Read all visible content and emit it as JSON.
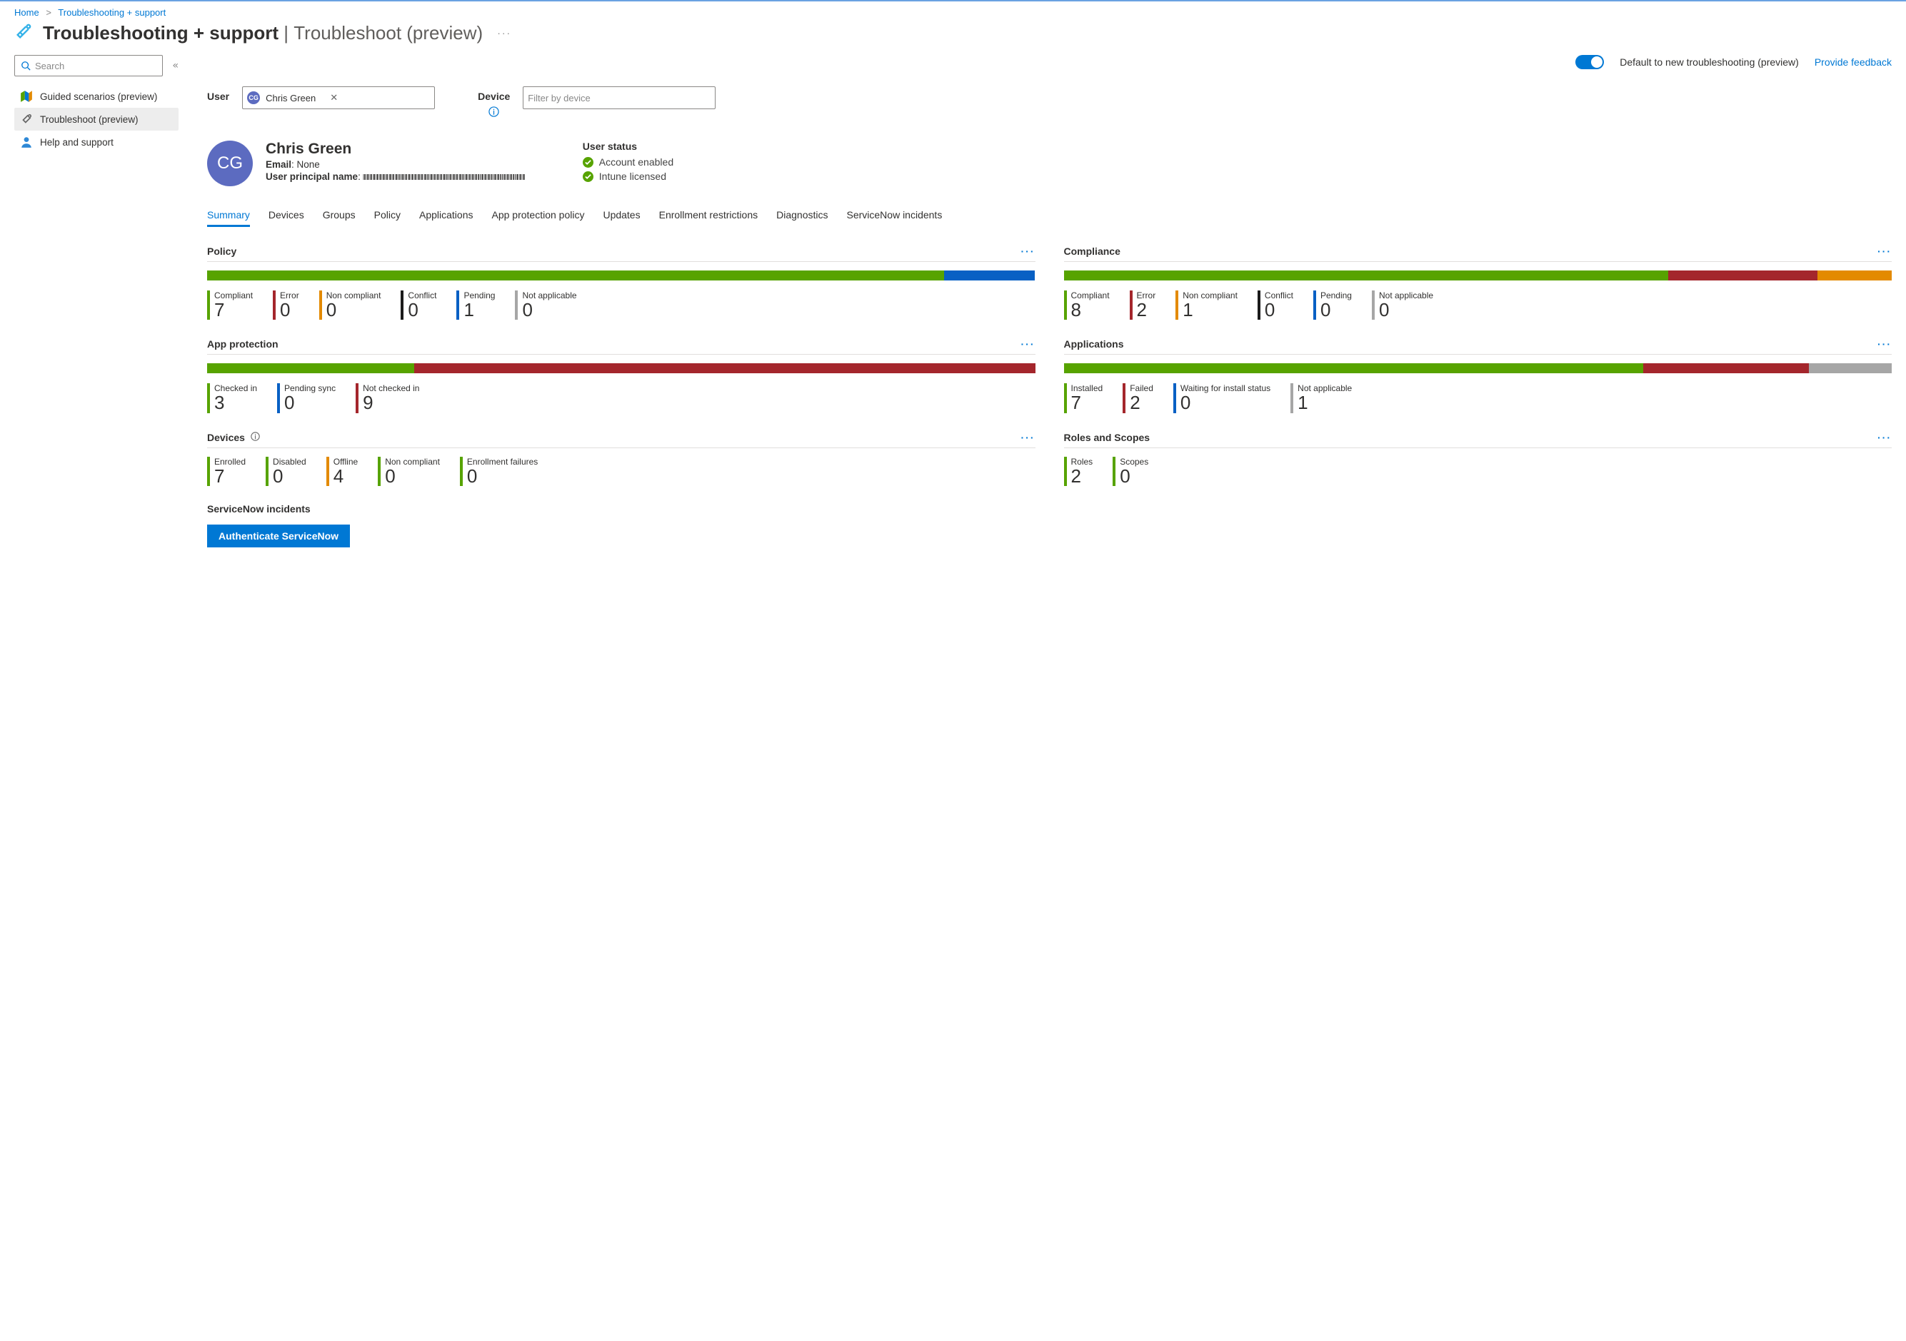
{
  "breadcrumb": {
    "home": "Home",
    "section": "Troubleshooting + support"
  },
  "title": {
    "main": "Troubleshooting + support",
    "sub": "Troubleshoot (preview)"
  },
  "sidebar": {
    "search_placeholder": "Search",
    "items": [
      {
        "label": "Guided scenarios (preview)"
      },
      {
        "label": "Troubleshoot (preview)"
      },
      {
        "label": "Help and support"
      }
    ]
  },
  "topbar": {
    "toggle_label": "Default to new troubleshooting (preview)",
    "feedback": "Provide feedback"
  },
  "filters": {
    "user_label": "User",
    "user_chip": "Chris Green",
    "user_initials": "CG",
    "device_label": "Device",
    "device_placeholder": "Filter by device"
  },
  "user": {
    "initials": "CG",
    "name": "Chris Green",
    "email_label": "Email",
    "email_value": "None",
    "upn_label": "User principal name",
    "upn_value": "||||||||||| |||||||| ||||| |||| |||| ||| || ||| |||",
    "status_header": "User status",
    "status1": "Account enabled",
    "status2": "Intune licensed"
  },
  "tabs": [
    "Summary",
    "Devices",
    "Groups",
    "Policy",
    "Applications",
    "App protection policy",
    "Updates",
    "Enrollment restrictions",
    "Diagnostics",
    "ServiceNow incidents"
  ],
  "cards": {
    "policy": {
      "title": "Policy",
      "segments": [
        {
          "color": "c-green",
          "pct": 89
        },
        {
          "color": "c-blue",
          "pct": 11
        }
      ],
      "stats": [
        {
          "label": "Compliant",
          "value": "7",
          "color": "c-green"
        },
        {
          "label": "Error",
          "value": "0",
          "color": "c-red"
        },
        {
          "label": "Non compliant",
          "value": "0",
          "color": "c-orange"
        },
        {
          "label": "Conflict",
          "value": "0",
          "color": "c-black"
        },
        {
          "label": "Pending",
          "value": "1",
          "color": "c-blue"
        },
        {
          "label": "Not applicable",
          "value": "0",
          "color": "c-gray"
        }
      ]
    },
    "compliance": {
      "title": "Compliance",
      "segments": [
        {
          "color": "c-green",
          "pct": 73
        },
        {
          "color": "c-red",
          "pct": 18
        },
        {
          "color": "c-orange",
          "pct": 9
        }
      ],
      "stats": [
        {
          "label": "Compliant",
          "value": "8",
          "color": "c-green"
        },
        {
          "label": "Error",
          "value": "2",
          "color": "c-red"
        },
        {
          "label": "Non compliant",
          "value": "1",
          "color": "c-orange"
        },
        {
          "label": "Conflict",
          "value": "0",
          "color": "c-black"
        },
        {
          "label": "Pending",
          "value": "0",
          "color": "c-blue"
        },
        {
          "label": "Not applicable",
          "value": "0",
          "color": "c-gray"
        }
      ]
    },
    "app_protection": {
      "title": "App protection",
      "segments": [
        {
          "color": "c-green",
          "pct": 25
        },
        {
          "color": "c-red",
          "pct": 75
        }
      ],
      "stats": [
        {
          "label": "Checked in",
          "value": "3",
          "color": "c-green"
        },
        {
          "label": "Pending sync",
          "value": "0",
          "color": "c-blue"
        },
        {
          "label": "Not checked in",
          "value": "9",
          "color": "c-red"
        }
      ]
    },
    "applications": {
      "title": "Applications",
      "segments": [
        {
          "color": "c-green",
          "pct": 70
        },
        {
          "color": "c-red",
          "pct": 20
        },
        {
          "color": "c-gray",
          "pct": 10
        }
      ],
      "stats": [
        {
          "label": "Installed",
          "value": "7",
          "color": "c-green"
        },
        {
          "label": "Failed",
          "value": "2",
          "color": "c-red"
        },
        {
          "label": "Waiting for install status",
          "value": "0",
          "color": "c-blue"
        },
        {
          "label": "Not applicable",
          "value": "1",
          "color": "c-gray"
        }
      ]
    },
    "devices": {
      "title": "Devices",
      "info": true,
      "stats": [
        {
          "label": "Enrolled",
          "value": "7",
          "color": "c-green"
        },
        {
          "label": "Disabled",
          "value": "0",
          "color": "c-green"
        },
        {
          "label": "Offline",
          "value": "4",
          "color": "c-orange"
        },
        {
          "label": "Non compliant",
          "value": "0",
          "color": "c-green"
        },
        {
          "label": "Enrollment failures",
          "value": "0",
          "color": "c-green"
        }
      ]
    },
    "roles": {
      "title": "Roles and Scopes",
      "stats": [
        {
          "label": "Roles",
          "value": "2",
          "color": "c-green"
        },
        {
          "label": "Scopes",
          "value": "0",
          "color": "c-green"
        }
      ]
    }
  },
  "servicenow": {
    "title": "ServiceNow incidents",
    "button": "Authenticate ServiceNow"
  },
  "chart_data": [
    {
      "type": "bar",
      "title": "Policy",
      "categories": [
        "Compliant",
        "Error",
        "Non compliant",
        "Conflict",
        "Pending",
        "Not applicable"
      ],
      "values": [
        7,
        0,
        0,
        0,
        1,
        0
      ]
    },
    {
      "type": "bar",
      "title": "Compliance",
      "categories": [
        "Compliant",
        "Error",
        "Non compliant",
        "Conflict",
        "Pending",
        "Not applicable"
      ],
      "values": [
        8,
        2,
        1,
        0,
        0,
        0
      ]
    },
    {
      "type": "bar",
      "title": "App protection",
      "categories": [
        "Checked in",
        "Pending sync",
        "Not checked in"
      ],
      "values": [
        3,
        0,
        9
      ]
    },
    {
      "type": "bar",
      "title": "Applications",
      "categories": [
        "Installed",
        "Failed",
        "Waiting for install status",
        "Not applicable"
      ],
      "values": [
        7,
        2,
        0,
        1
      ]
    },
    {
      "type": "table",
      "title": "Devices",
      "categories": [
        "Enrolled",
        "Disabled",
        "Offline",
        "Non compliant",
        "Enrollment failures"
      ],
      "values": [
        7,
        0,
        4,
        0,
        0
      ]
    },
    {
      "type": "table",
      "title": "Roles and Scopes",
      "categories": [
        "Roles",
        "Scopes"
      ],
      "values": [
        2,
        0
      ]
    }
  ]
}
